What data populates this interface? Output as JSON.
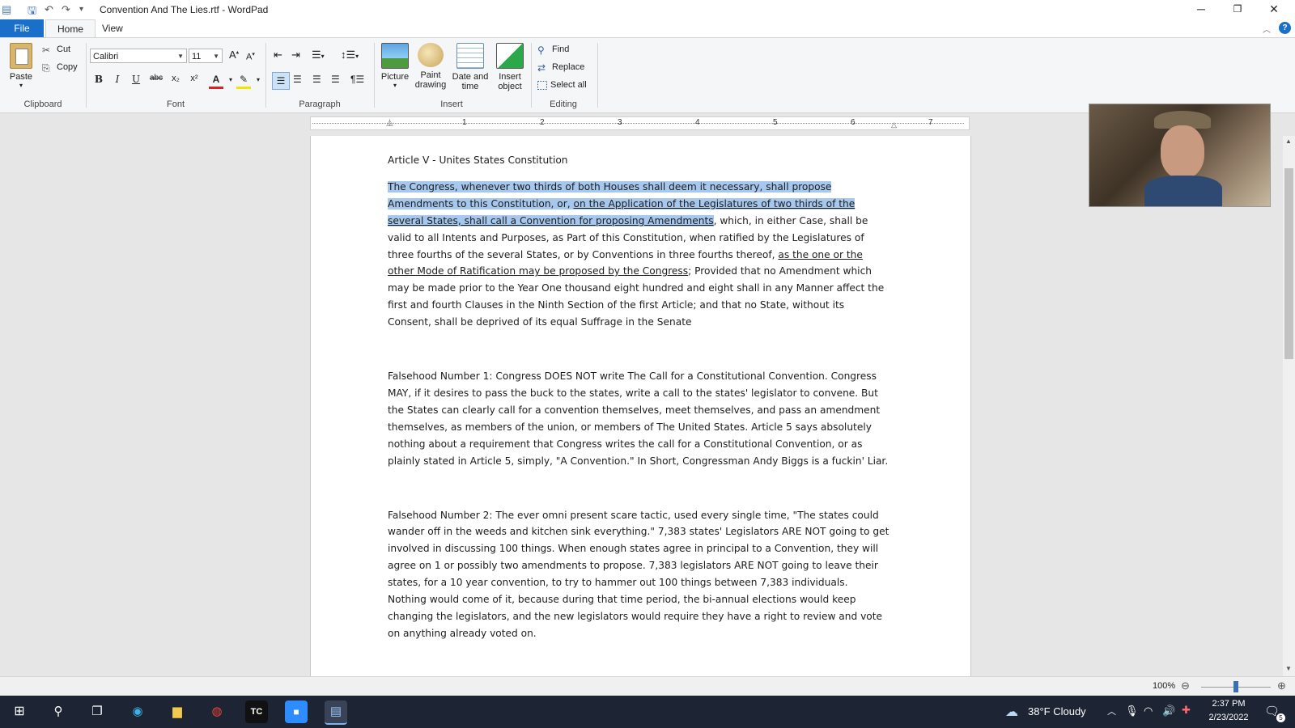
{
  "window": {
    "title": "Convention And The Lies.rtf - WordPad",
    "quick_access": [
      "app-icon",
      "save-icon",
      "undo-icon",
      "redo-icon",
      "customize-icon"
    ],
    "controls": {
      "minimize": "─",
      "restore": "❐",
      "close": "✕"
    }
  },
  "tabs": {
    "file": "File",
    "home": "Home",
    "view": "View"
  },
  "ribbon": {
    "clipboard": {
      "paste": "Paste",
      "cut": "Cut",
      "copy": "Copy",
      "label": "Clipboard"
    },
    "font": {
      "family": "Calibri",
      "size": "11",
      "bold": "B",
      "italic": "I",
      "underline": "U",
      "strike": "abc",
      "sub": "x₂",
      "sup": "x²",
      "color": "A",
      "label": "Font"
    },
    "paragraph": {
      "label": "Paragraph"
    },
    "insert": {
      "picture": "Picture",
      "paint": "Paint\ndrawing",
      "datetime": "Date and\ntime",
      "object": "Insert\nobject",
      "label": "Insert",
      "picture_l1": "Picture",
      "paint_l1": "Paint",
      "paint_l2": "drawing",
      "dt_l1": "Date and",
      "dt_l2": "time",
      "obj_l1": "Insert",
      "obj_l2": "object"
    },
    "editing": {
      "find": "Find",
      "replace": "Replace",
      "select_all": "Select all",
      "label": "Editing"
    }
  },
  "ruler": {
    "numbers": [
      "1",
      "2",
      "3",
      "4",
      "5",
      "6",
      "7"
    ]
  },
  "document": {
    "heading": "Article V - Unites States Constitution",
    "article": {
      "sel1": "The Congress, whenever two thirds of both Houses shall deem it necessary, shall propose Amendments to this Constitution, or, ",
      "sel_underlined": "on the Application of the Legislatures of two thirds of the several States, shall call a Convention for proposing Amendments",
      "rest1": ", which, in either Case, shall be valid to all Intents and Purposes, as Part of this Constitution, when ratified by the Legislatures of three fourths of the several States, or by Conventions in three fourths thereof, ",
      "underlined2": "as the one or the other Mode of Ratification may be proposed by the Congress",
      "rest2": "; Provided that no Amendment which may be made prior to the Year One thousand eight hundred and eight shall in any Manner affect the first and fourth Clauses in the Ninth Section of the first Article; and that no State, without its Consent, shall be deprived of its equal Suffrage in the Senate"
    },
    "falsehood1": "Falsehood Number 1:  Congress DOES NOT write The Call for a Constitutional Convention.  Congress MAY, if it desires to pass the buck to the states, write a call to the states' legislator to convene.  But the States can clearly call for a convention themselves, meet themselves, and pass an amendment themselves, as members of the union, or members of The United States.  Article 5 says absolutely nothing about a requirement that Congress writes the call for a Constitutional Convention, or as plainly stated in Article 5, simply, \"A Convention.\"  In Short, Congressman Andy Biggs is a fuckin' Liar.",
    "falsehood2": "Falsehood Number 2:  The ever omni present scare tactic, used every single time, \"The states could wander off in the weeds and kitchen sink everything.\"  7,383 states' Legislators ARE NOT going to get involved in discussing 100 things.  When enough states agree in principal to a Convention, they will agree on 1 or possibly two amendments to propose.  7,383 legislators ARE NOT going to leave their states, for a 10 year convention, to try to hammer out 100 things between 7,383 individuals.  Nothing would come of it, because during that time period, the bi-annual elections would keep changing the legislators, and the new legislators would require they have a right to review and vote on anything already voted on."
  },
  "status": {
    "zoom": "100%",
    "zoom_level": 0.5
  },
  "taskbar": {
    "weather": "38°F  Cloudy",
    "time": "2:37 PM",
    "date": "2/23/2022",
    "notifications": "5"
  },
  "colors": {
    "accent": "#1a6fc9",
    "selection": "#a7c8ee",
    "taskbar": "#1d2433"
  }
}
